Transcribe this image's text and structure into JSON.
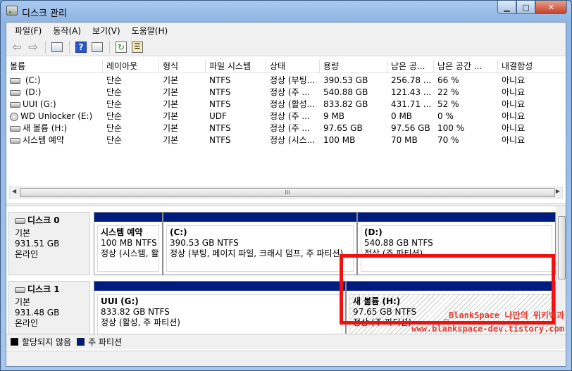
{
  "window": {
    "title": "디스크 관리",
    "caption_min": "▁",
    "caption_max": "□",
    "caption_close": "✕"
  },
  "menu": [
    "파일(F)",
    "동작(A)",
    "보기(V)",
    "도움말(H)"
  ],
  "volumes": {
    "columns": [
      "볼륨",
      "레이아웃",
      "형식",
      "파일 시스템",
      "상태",
      "용량",
      "남은 공...",
      "남은 공간 ...",
      "내결함성"
    ],
    "rows": [
      {
        "icon": "disk",
        "cells": [
          " (C:)",
          "단순",
          "기본",
          "NTFS",
          "정상 (부팅...",
          "390.53 GB",
          "256.78 ...",
          "66 %",
          "아니요"
        ]
      },
      {
        "icon": "disk",
        "cells": [
          " (D:)",
          "단순",
          "기본",
          "NTFS",
          "정상 (주 ...",
          "540.88 GB",
          "121.43 ...",
          "22 %",
          "아니요"
        ]
      },
      {
        "icon": "disk",
        "cells": [
          "UUI (G:)",
          "단순",
          "기본",
          "NTFS",
          "정상 (활성...",
          "833.82 GB",
          "431.71 ...",
          "52 %",
          "아니요"
        ]
      },
      {
        "icon": "cd",
        "cells": [
          "WD Unlocker (E:)",
          "단순",
          "기본",
          "UDF",
          "정상 (주 ...",
          "9 MB",
          "0 MB",
          "0 %",
          "아니요"
        ]
      },
      {
        "icon": "disk",
        "cells": [
          "새 볼륨 (H:)",
          "단순",
          "기본",
          "NTFS",
          "정상 (주 ...",
          "97.65 GB",
          "97.56 GB",
          "100 %",
          "아니요"
        ]
      },
      {
        "icon": "disk",
        "cells": [
          "시스템 예약",
          "단순",
          "기본",
          "NTFS",
          "정상 (시스...",
          "100 MB",
          "70 MB",
          "70 %",
          "아니요"
        ]
      }
    ],
    "scroll_grip": "III"
  },
  "disks": [
    {
      "name": "디스크 0",
      "type": "기본",
      "size": "931.51 GB",
      "status": "온라인",
      "partitions": [
        {
          "name": "시스템 예약",
          "size": "100 MB NTFS",
          "status": "정상 (시스템, 활"
        },
        {
          "name": " (C:)",
          "size": "390.53 GB NTFS",
          "status": "정상 (부팅, 페이지 파일, 크래시 덤프, 주 파티션)"
        },
        {
          "name": " (D:)",
          "size": "540.88 GB NTFS",
          "status": "정상 (주 파티션)"
        }
      ]
    },
    {
      "name": "디스크 1",
      "type": "기본",
      "size": "931.48 GB",
      "status": "온라인",
      "partitions": [
        {
          "name": "UUI  (G:)",
          "size": "833.82 GB NTFS",
          "status": "정상 (활성, 주 파티션)"
        },
        {
          "name": "새 볼륨  (H:)",
          "size": "97.65 GB NTFS",
          "status": "정상 (주 파티션)"
        }
      ]
    }
  ],
  "legend": [
    {
      "label": "할당되지 않음",
      "color": "#000000"
    },
    {
      "label": "주 파티션",
      "color": "#001c80"
    }
  ],
  "watermark": {
    "line1": "_BlankSpace 나만의 위키백과",
    "line2": "www.blankspace-dev.tistory.com"
  },
  "colors": {
    "primary_partition": "#001c80",
    "highlight": "#ef1010"
  }
}
